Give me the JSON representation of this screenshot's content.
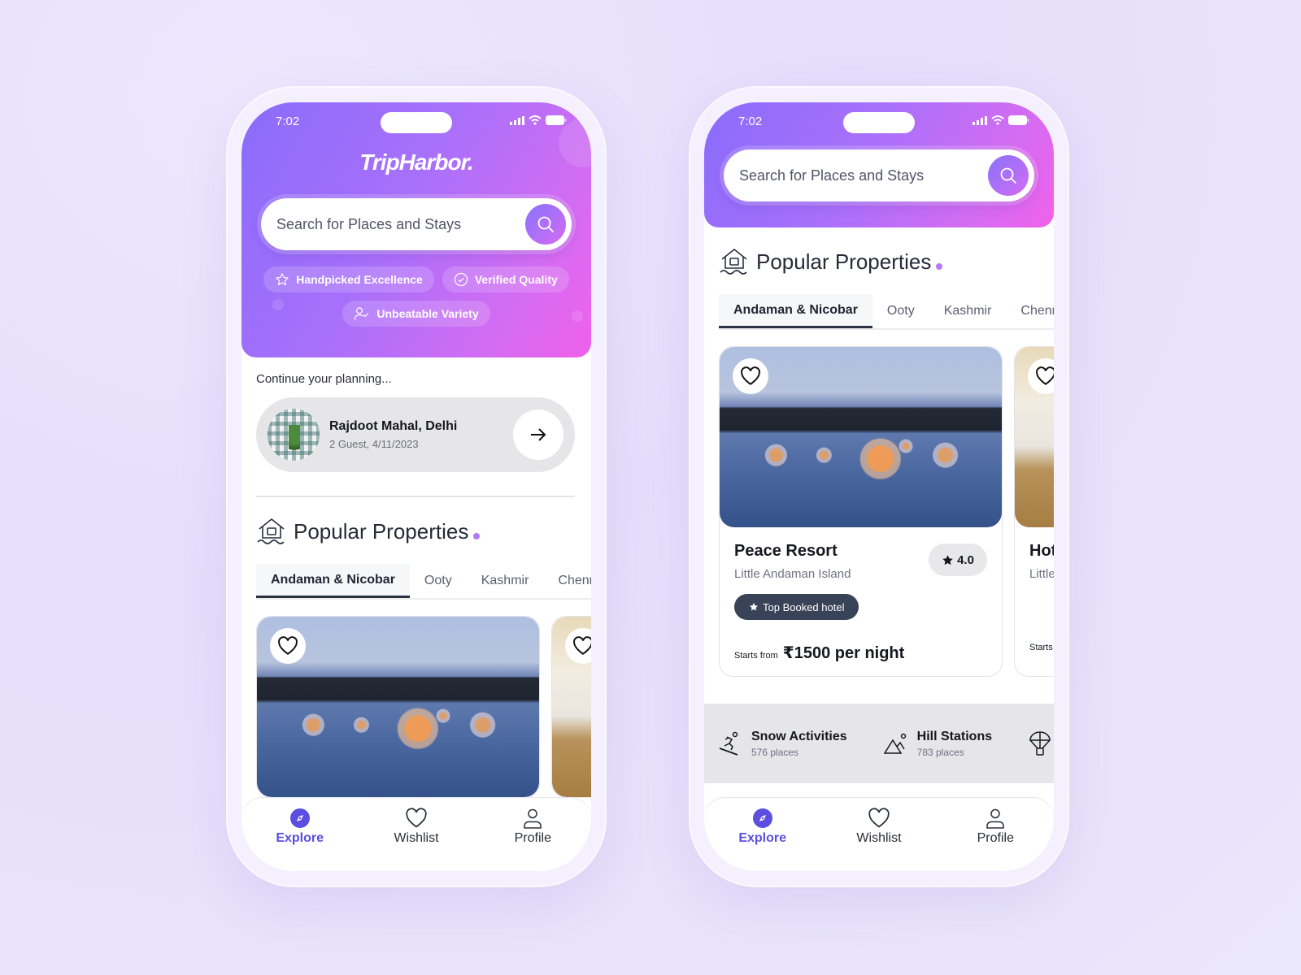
{
  "colors": {
    "accent": "#5b4ee0",
    "gradient_start": "#8a6cfb",
    "gradient_end": "#f061ea",
    "badge_bg": "#394357",
    "dot": "#b47af5"
  },
  "status_bar": {
    "time": "7:02"
  },
  "app": {
    "logo": "TripHarbor."
  },
  "search": {
    "placeholder": "Search for Places and Stays"
  },
  "features": [
    {
      "icon": "star-outline-icon",
      "label": "Handpicked Excellence"
    },
    {
      "icon": "check-circle-icon",
      "label": "Verified Quality"
    },
    {
      "icon": "user-check-icon",
      "label": "Unbeatable Variety"
    }
  ],
  "continue_planning": {
    "label": "Continue your planning...",
    "title": "Rajdoot Mahal, Delhi",
    "subtitle": "2 Guest, 4/11/2023"
  },
  "popular": {
    "title": "Popular Properties",
    "tabs": [
      "Andaman & Nicobar",
      "Ooty",
      "Kashmir",
      "Chennai"
    ],
    "active_tab": 0,
    "cards": [
      {
        "name": "Peace Resort",
        "location": "Little Andaman Island",
        "rating": "4.0",
        "badge": "Top Booked hotel",
        "price_prefix": "Starts from",
        "price": "₹1500 per night",
        "wishlisted": false
      },
      {
        "name": "Hotel",
        "location": "Little Andaman Island",
        "price_prefix": "Starts from",
        "wishlisted": false
      }
    ]
  },
  "categories": [
    {
      "icon": "snowboard-icon",
      "title": "Snow Activities",
      "count": "576 places"
    },
    {
      "icon": "mountain-icon",
      "title": "Hill Stations",
      "count": "783 places"
    },
    {
      "icon": "parachute-icon",
      "title": "",
      "count": ""
    }
  ],
  "nav": [
    {
      "icon": "compass-icon",
      "label": "Explore",
      "active": true
    },
    {
      "icon": "heart-icon",
      "label": "Wishlist",
      "active": false
    },
    {
      "icon": "user-icon",
      "label": "Profile",
      "active": false
    }
  ]
}
